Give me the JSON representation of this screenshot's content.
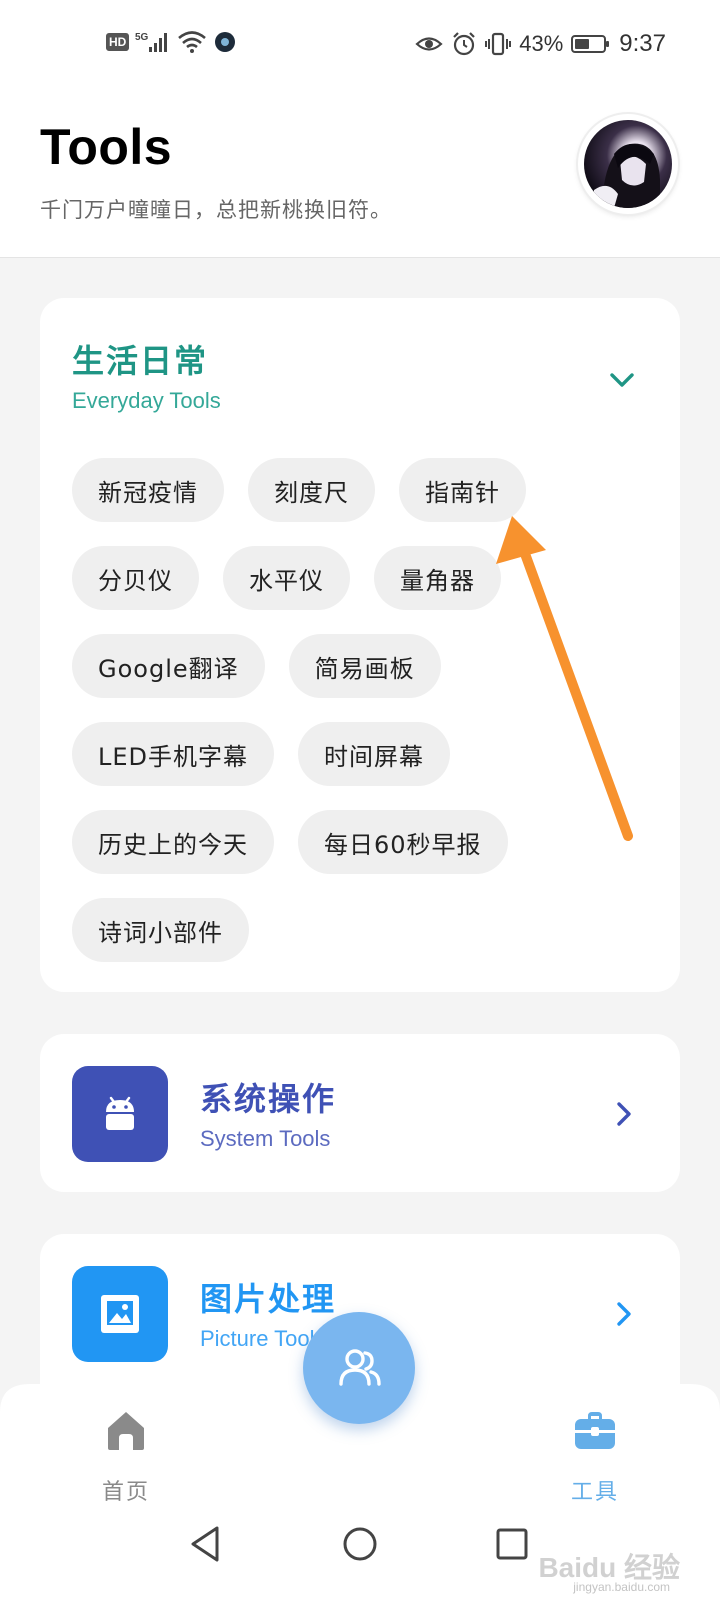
{
  "status_bar": {
    "hd_badge": "HD",
    "network": "5G",
    "icons_left": [
      "signal-icon",
      "wifi-icon",
      "app-notification-icon"
    ],
    "icons_right": [
      "eye-icon",
      "alarm-icon",
      "vibrate-icon",
      "battery-icon"
    ],
    "battery": "43%",
    "time": "9:37"
  },
  "header": {
    "title": "Tools",
    "subtitle": "千门万户曈曈日，总把新桃换旧符。"
  },
  "everyday": {
    "title": "生活日常",
    "subtitle": "Everyday Tools",
    "icon": "chevron-down-icon",
    "accent": "#1f9585",
    "chips": [
      "新冠疫情",
      "刻度尺",
      "指南针",
      "分贝仪",
      "水平仪",
      "量角器",
      "Google翻译",
      "简易画板",
      "LED手机字幕",
      "时间屏幕",
      "历史上的今天",
      "每日60秒早报",
      "诗词小部件"
    ]
  },
  "system": {
    "title": "系统操作",
    "subtitle": "System Tools",
    "icon": "android-icon",
    "color": "#3f51b5",
    "subtitle_color": "#5c6bc0"
  },
  "picture": {
    "title": "图片处理",
    "subtitle": "Picture Tools",
    "icon": "image-icon",
    "color": "#2196f3",
    "subtitle_color": "#42a5f5"
  },
  "bottom_nav": {
    "home_label": "首页",
    "tools_label": "工具",
    "home_icon": "home-icon",
    "tools_icon": "toolbox-icon",
    "fab_icon": "community-icon",
    "active_color": "#64aee8",
    "inactive_color": "#8a8a8a"
  },
  "system_nav": [
    "back-icon",
    "home-circle-icon",
    "recents-icon"
  ],
  "annotation": {
    "color": "#f7922e",
    "icon": "arrow-icon"
  },
  "watermark": {
    "text": "Baidu 经验",
    "sub": "jingyan.baidu.com"
  }
}
